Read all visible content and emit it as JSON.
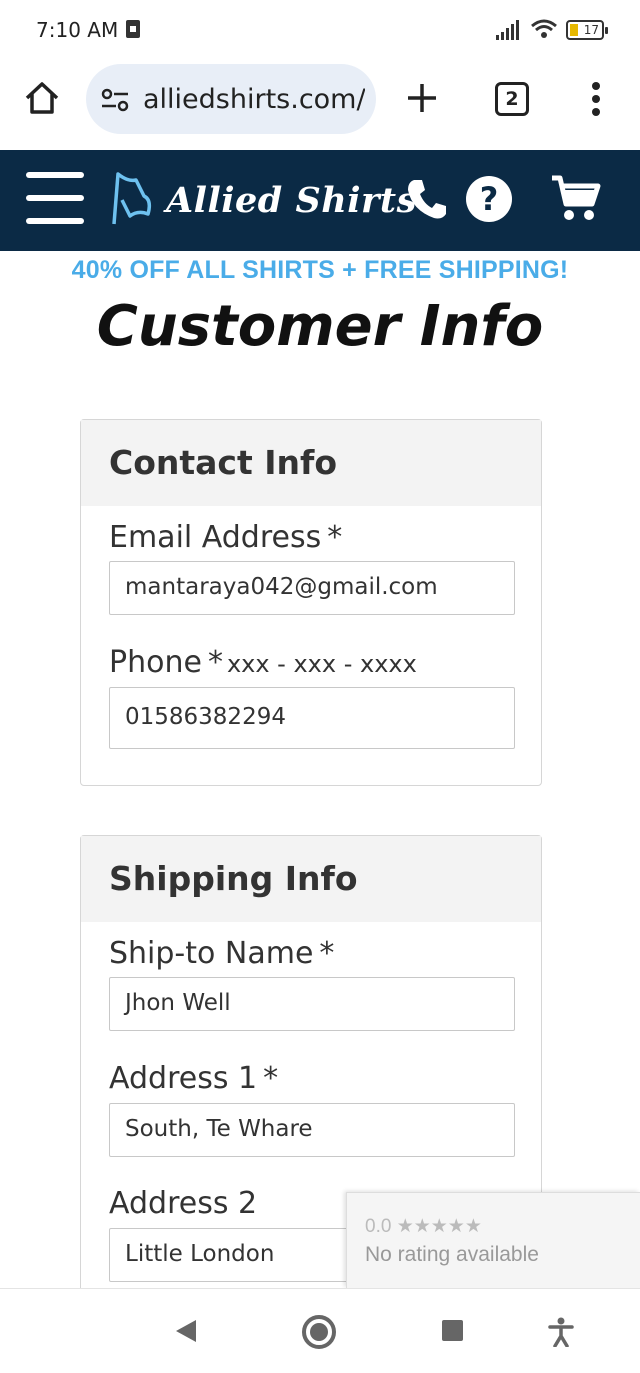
{
  "status_bar": {
    "time": "7:10 AM",
    "battery": "17",
    "icons": [
      "notification-icon",
      "signal-icon",
      "wifi-icon",
      "battery-icon"
    ]
  },
  "browser": {
    "url": "alliedshirts.com/c",
    "tab_count": "2",
    "icons": [
      "home-icon",
      "site-settings-icon",
      "plus-icon",
      "more-vert-icon"
    ]
  },
  "site_header": {
    "logo_text": "Allied Shirts",
    "bg_color": "#0b2a45",
    "icons": [
      "hamburger-menu-icon",
      "logo-flag-icon",
      "phone-icon",
      "help-icon",
      "cart-icon"
    ],
    "help_glyph": "?"
  },
  "promo": {
    "text": "40% OFF ALL SHIRTS + FREE SHIPPING!",
    "color": "#4aace8"
  },
  "page_title": "Customer Info",
  "contact_info": {
    "heading": "Contact Info",
    "email_label": "Email Address",
    "email_value": "mantaraya042@gmail.com",
    "phone_label": "Phone",
    "phone_hint": "xxx - xxx - xxxx",
    "phone_value": "01586382294",
    "required_mark": "*"
  },
  "shipping_info": {
    "heading": "Shipping Info",
    "name_label": "Ship-to Name",
    "name_value": "Jhon Well",
    "address1_label": "Address 1",
    "address1_value": "South, Te Whare",
    "address2_label": "Address 2",
    "address2_value": "Little London",
    "required_mark": "*"
  },
  "rating_widget": {
    "score": "0.0",
    "stars": "★★★★★",
    "text": "No rating available"
  },
  "nav_bar": {
    "icons": [
      "back-icon",
      "home-circle-icon",
      "recents-icon",
      "accessibility-icon"
    ]
  }
}
